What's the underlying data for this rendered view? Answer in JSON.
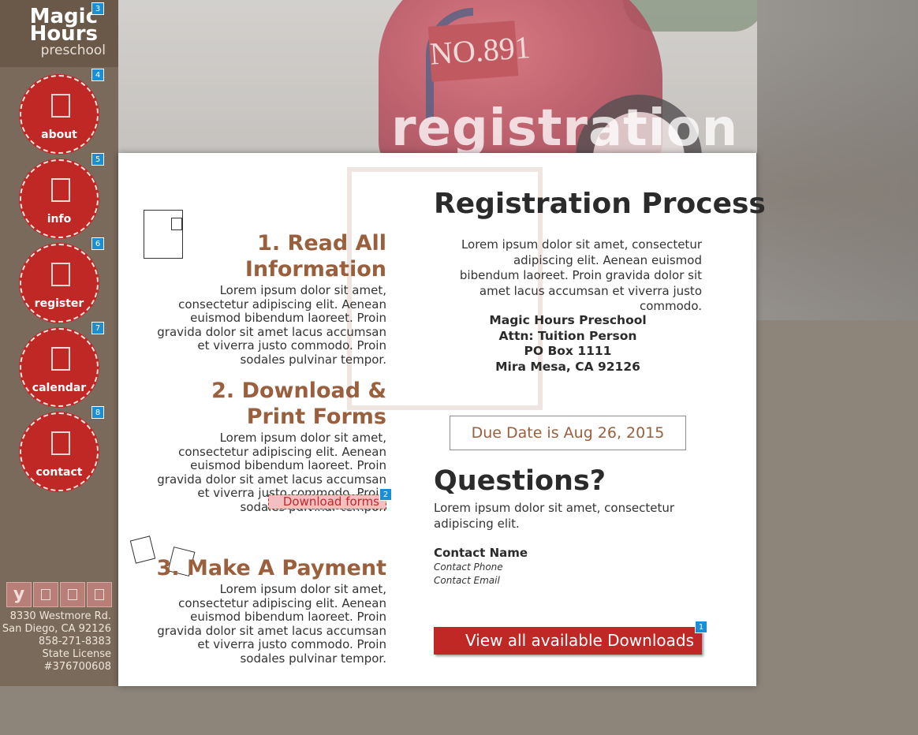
{
  "logo": {
    "line1": "Magic",
    "line2": "Hours",
    "line3": "preschool",
    "badge": "3"
  },
  "nav": [
    {
      "label": "about",
      "badge": "4",
      "icon": "info-icon"
    },
    {
      "label": "info",
      "badge": "5",
      "icon": "book-icon"
    },
    {
      "label": "register",
      "badge": "6",
      "icon": "pencil-icon"
    },
    {
      "label": "calendar",
      "badge": "7",
      "icon": "calendar-icon"
    },
    {
      "label": "contact",
      "badge": "8",
      "icon": "envelope-icon"
    }
  ],
  "social": [
    {
      "label": "y",
      "icon": "yelp-icon"
    },
    {
      "label": "",
      "icon": "facebook-icon"
    },
    {
      "label": "",
      "icon": "twitter-icon"
    },
    {
      "label": "",
      "icon": "pinterest-icon"
    }
  ],
  "address": {
    "street": "8330 Westmore Rd.",
    "city": "San Diego, CA 92126",
    "phone": "858-271-8383",
    "license_label": "State License",
    "license_number": "#376700608"
  },
  "hero": {
    "title": "registration",
    "plate": "NO.891"
  },
  "steps": [
    {
      "title": "1.  Read All Information",
      "body": "Lorem ipsum dolor sit amet, consectetur adipiscing elit. Aenean euismod bibendum laoreet. Proin gravida dolor sit amet lacus accumsan et viverra justo commodo. Proin sodales pulvinar tempor."
    },
    {
      "title": "2. Download & Print Forms",
      "body": "Lorem ipsum dolor sit amet, consectetur adipiscing elit. Aenean euismod bibendum laoreet. Proin gravida dolor sit amet lacus accumsan et viverra justo commodo. Proin sodales pulvinar tempor.",
      "link": "Download forms",
      "link_badge": "2"
    },
    {
      "title": "3. Make A Payment",
      "body": "Lorem ipsum dolor sit amet, consectetur adipiscing elit. Aenean euismod bibendum laoreet. Proin gravida dolor sit amet lacus accumsan et viverra justo commodo. Proin sodales pulvinar tempor."
    }
  ],
  "process": {
    "title": "Registration Process",
    "intro": "Lorem ipsum dolor sit amet, consectetur adipiscing elit. Aenean euismod bibendum laoreet. Proin gravida dolor sit amet lacus accumsan et viverra justo commodo.",
    "mail_name": "Magic Hours Preschool",
    "mail_attn": "Attn: Tuition Person",
    "mail_box": "PO Box 1111",
    "mail_city": "Mira Mesa, CA 92126",
    "due": "Due Date is Aug 26, 2015"
  },
  "questions": {
    "title": "Questions?",
    "text": "Lorem ipsum dolor sit amet, consectetur adipiscing elit.",
    "contact_name": "Contact Name",
    "contact_phone": "Contact Phone",
    "contact_email": "Contact Email"
  },
  "downloads_button": {
    "label": "View all available Downloads",
    "badge": "1"
  },
  "colors": {
    "accent": "#c02826",
    "heading": "#9a5f3c",
    "sidebar": "#7a6a5b",
    "badge": "#1a8fd6"
  }
}
